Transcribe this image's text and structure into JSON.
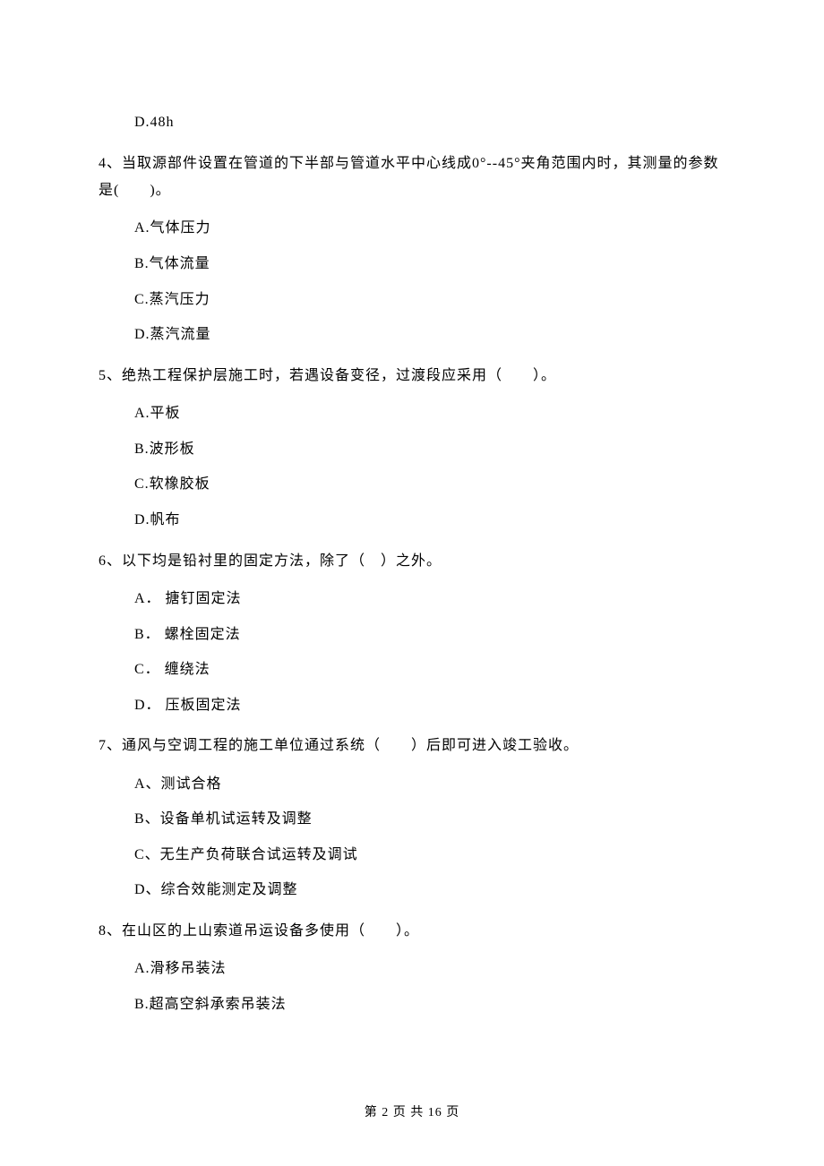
{
  "q3_trailing_option": {
    "d": "D.48h"
  },
  "questions": [
    {
      "number": "4、",
      "stem": "当取源部件设置在管道的下半部与管道水平中心线成0°--45°夹角范围内时，其测量的参数是(　　)。",
      "options": [
        "A.气体压力",
        "B.气体流量",
        "C.蒸汽压力",
        "D.蒸汽流量"
      ]
    },
    {
      "number": "5、",
      "stem": "绝热工程保护层施工时，若遇设备变径，过渡段应采用（　　）。",
      "options": [
        "A.平板",
        "B.波形板",
        "C.软橡胶板",
        "D.帆布"
      ]
    },
    {
      "number": "6、",
      "stem": "以下均是铅衬里的固定方法，除了（　）之外。",
      "options": [
        "A． 搪钉固定法",
        "B． 螺栓固定法",
        "C． 缠绕法",
        "D． 压板固定法"
      ]
    },
    {
      "number": "7、",
      "stem": "通风与空调工程的施工单位通过系统（　　）后即可进入竣工验收。",
      "options": [
        "A、测试合格",
        "B、设备单机试运转及调整",
        "C、无生产负荷联合试运转及调试",
        "D、综合效能测定及调整"
      ]
    },
    {
      "number": "8、",
      "stem": "在山区的上山索道吊运设备多使用（　　）。",
      "options": [
        "A.滑移吊装法",
        "B.超高空斜承索吊装法"
      ]
    }
  ],
  "footer": "第 2 页 共 16 页"
}
